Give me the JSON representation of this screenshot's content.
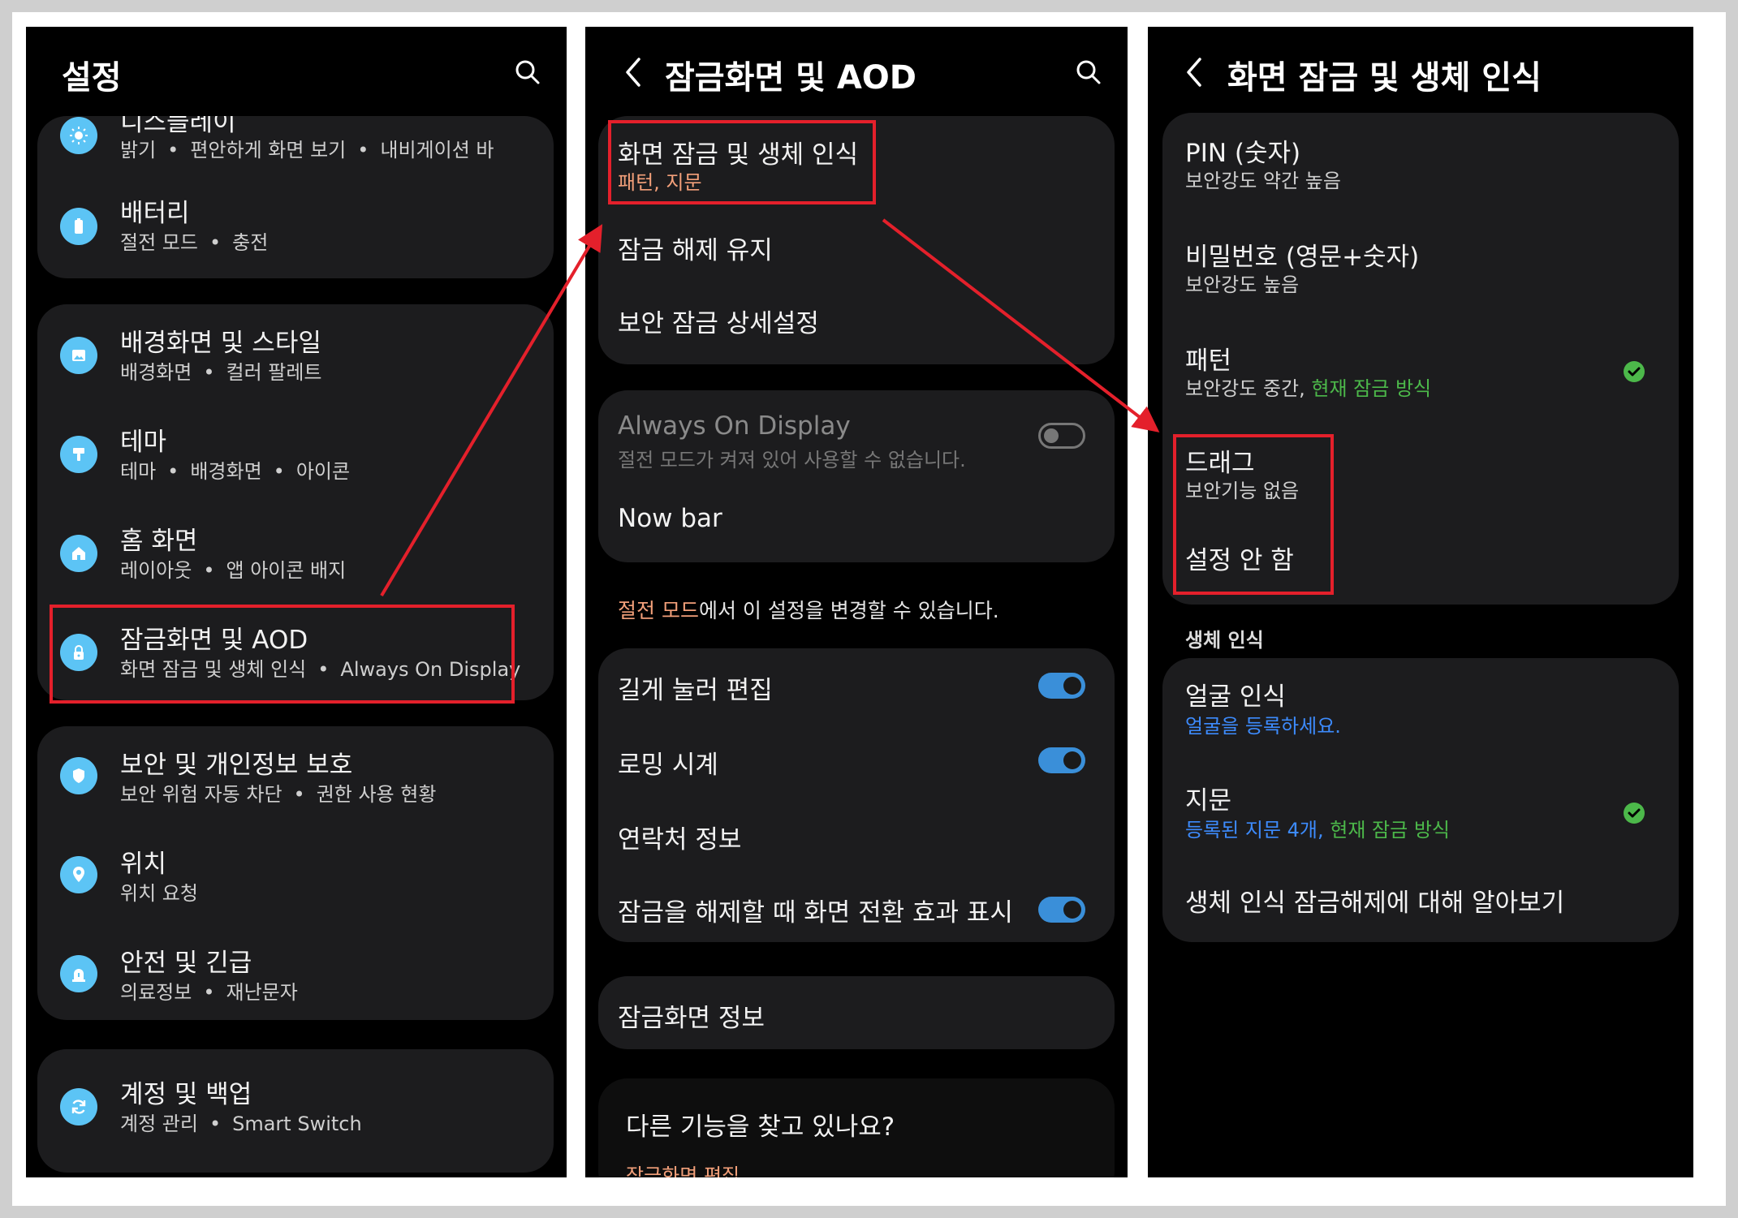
{
  "colors": {
    "highlight": "#e4202b",
    "icon_bg": "#5cc4f5",
    "toggle_on": "#3a8fd9",
    "check": "#4cb84a",
    "orange_text": "#f3a07a",
    "blue_text": "#3d8bfd"
  },
  "screen1": {
    "title": "설정",
    "search_icon": "search-icon",
    "cards": [
      {
        "items": [
          {
            "icon": "brightness-icon",
            "title": "디스플레이",
            "sub": [
              "밝기",
              "편안하게 화면 보기",
              "내비게이션 바"
            ]
          },
          {
            "icon": "battery-icon",
            "title": "배터리",
            "sub": [
              "절전 모드",
              "충전"
            ]
          }
        ]
      },
      {
        "items": [
          {
            "icon": "image-icon",
            "title": "배경화면 및 스타일",
            "sub": [
              "배경화면",
              "컬러 팔레트"
            ]
          },
          {
            "icon": "brush-icon",
            "title": "테마",
            "sub": [
              "테마",
              "배경화면",
              "아이콘"
            ]
          },
          {
            "icon": "home-icon",
            "title": "홈 화면",
            "sub": [
              "레이아웃",
              "앱 아이콘 배지"
            ]
          },
          {
            "icon": "lock-icon",
            "title": "잠금화면 및 AOD",
            "sub": [
              "화면 잠금 및 생체 인식",
              "Always On Display"
            ]
          }
        ]
      },
      {
        "items": [
          {
            "icon": "shield-icon",
            "title": "보안 및 개인정보 보호",
            "sub": [
              "보안 위험 자동 차단",
              "권한 사용 현황"
            ]
          },
          {
            "icon": "location-icon",
            "title": "위치",
            "sub": [
              "위치 요청"
            ]
          },
          {
            "icon": "emergency-icon",
            "title": "안전 및 긴급",
            "sub": [
              "의료정보",
              "재난문자"
            ]
          }
        ]
      },
      {
        "items": [
          {
            "icon": "sync-icon",
            "title": "계정 및 백업",
            "sub": [
              "계정 관리",
              "Smart Switch"
            ]
          }
        ]
      }
    ]
  },
  "screen2": {
    "title": "잠금화면 및 AOD",
    "card1": {
      "item1_title": "화면 잠금 및 생체 인식",
      "item1_sub": "패턴, 지문",
      "item2_title": "잠금 해제 유지",
      "item3_title": "보안 잠금 상세설정"
    },
    "card2": {
      "aod_title": "Always On Display",
      "aod_sub": "절전 모드가 켜져 있어 사용할 수 없습니다.",
      "aod_toggle": false,
      "nowbar_title": "Now bar"
    },
    "note_highlight": "절전 모드",
    "note_rest": "에서 이 설정을 변경할 수 있습니다.",
    "card3": {
      "item1_title": "길게 눌러 편집",
      "item1_toggle": true,
      "item2_title": "로밍 시계",
      "item2_toggle": true,
      "item3_title": "연락처 정보",
      "item4_title": "잠금을 해제할 때 화면 전환 효과 표시",
      "item4_toggle": true
    },
    "card4": {
      "item1_title": "잠금화면 정보"
    },
    "bottom_title": "다른 기능을 찾고 있나요?",
    "bottom_link": "잠금화면 편집"
  },
  "screen3": {
    "title": "화면 잠금 및 생체 인식",
    "card1": {
      "pin_title": "PIN (숫자)",
      "pin_sub": "보안강도 약간 높음",
      "password_title": "비밀번호 (영문+숫자)",
      "password_sub": "보안강도 높음",
      "pattern_title": "패턴",
      "pattern_sub": "보안강도 중간, ",
      "pattern_sub_green": "현재 잠금 방식",
      "drag_title": "드래그",
      "drag_sub": "보안기능 없음",
      "none_title": "설정 안 함"
    },
    "section_label": "생체 인식",
    "card2": {
      "face_title": "얼굴 인식",
      "face_sub": "얼굴을 등록하세요.",
      "finger_title": "지문",
      "finger_sub_blue": "등록된 지문 4개, ",
      "finger_sub_green": "현재 잠금 방식",
      "learn_title": "생체 인식 잠금해제에 대해 알아보기"
    }
  }
}
